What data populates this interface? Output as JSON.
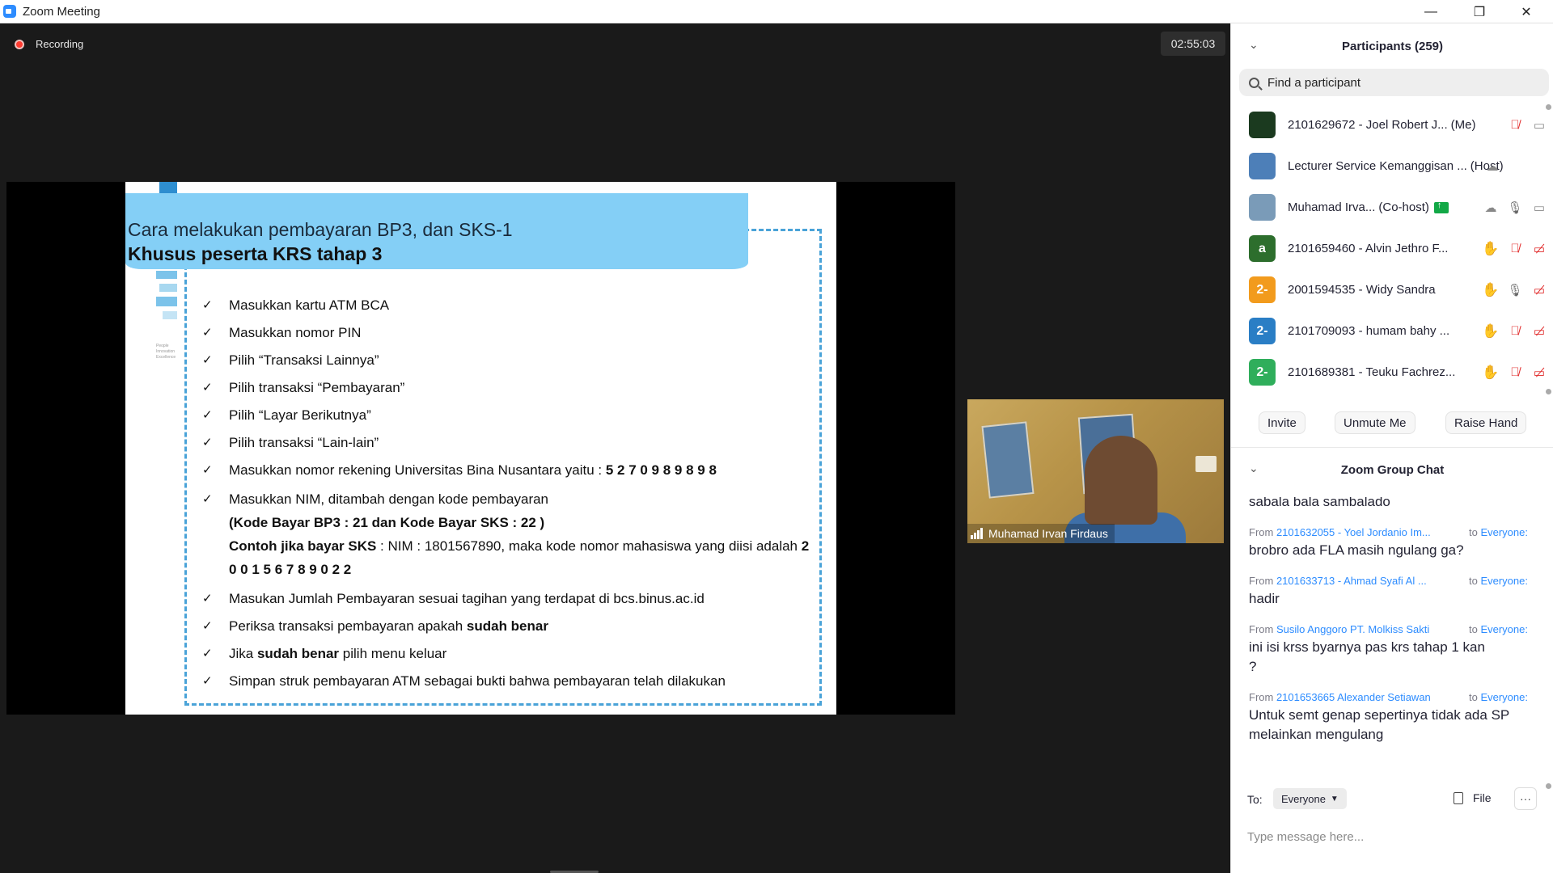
{
  "window": {
    "title": "Zoom Meeting",
    "controls": {
      "minimize": "—",
      "maximize": "❐",
      "close": "✕"
    }
  },
  "meeting": {
    "recording_label": "Recording",
    "elapsed_time": "02:55:03"
  },
  "slide": {
    "title": "Cara melakukan pembayaran BP3, dan SKS-1",
    "subtitle": "Khusus peserta KRS tahap 3",
    "side_text": "People\nInnovation\nExcellence",
    "items": [
      {
        "text": "Masukkan kartu ATM BCA"
      },
      {
        "text": "Masukkan nomor PIN"
      },
      {
        "text": "Pilih “Transaksi Lainnya”"
      },
      {
        "text": "Pilih transaksi “Pembayaran”"
      },
      {
        "text": "Pilih “Layar Berikutnya”"
      },
      {
        "text": "Pilih transaksi “Lain-lain”"
      },
      {
        "text": "Masukkan nomor rekening Universitas Bina Nusantara yaitu : ",
        "bold": "5 2 7 0 9 8 9 8 9 8"
      },
      {
        "text": "Masukkan NIM, ditambah dengan kode pembayaran",
        "line2_bold": "(Kode Bayar BP3 : 21 dan Kode Bayar SKS : 22 )",
        "line3_bold": "Contoh jika bayar SKS",
        "line3_text": " : NIM : 1801567890, maka kode nomor mahasiswa yang diisi adalah ",
        "line3_bold2": "2 0 0 1 5 6 7 8 9 0 2 2"
      },
      {
        "text": "Masukan Jumlah Pembayaran sesuai tagihan yang terdapat di bcs.binus.ac.id"
      },
      {
        "text": "Periksa transaksi pembayaran apakah ",
        "bold": "sudah benar"
      },
      {
        "text": "Jika ",
        "bold": "sudah benar",
        "after": " pilih menu keluar"
      },
      {
        "text": "Simpan struk pembayaran ATM sebagai bukti bahwa pembayaran telah dilakukan"
      }
    ]
  },
  "speaker": {
    "name": "Muhamad Irvan Firdaus"
  },
  "participants_panel": {
    "title": "Participants (259)",
    "search_placeholder": "Find a participant",
    "participants": [
      {
        "name": "2101629672 - Joel Robert J...",
        "tag": "(Me)",
        "avatar_color": "#1b3a1f",
        "avatar_text": "",
        "icons": [
          "mute",
          "video"
        ]
      },
      {
        "name": "Lecturer Service Kemanggisan ...",
        "tag": "(Host)",
        "avatar_color": "#4d7fb8",
        "avatar_text": "",
        "icons": [
          "cloud"
        ]
      },
      {
        "name": "Muhamad Irva...",
        "tag": "(Co-host)",
        "avatar_color": "#7a9bb8",
        "avatar_text": "",
        "icons": [
          "share",
          "cloud",
          "mic",
          "video"
        ]
      },
      {
        "name": "2101659460 - Alvin Jethro F...",
        "tag": "",
        "avatar_color": "#2d6e2d",
        "avatar_text": "a",
        "icons": [
          "hand",
          "mute",
          "videooff"
        ]
      },
      {
        "name": "2001594535 - Widy Sandra",
        "tag": "",
        "avatar_color": "#f29b1d",
        "avatar_text": "2-",
        "icons": [
          "hand",
          "mic",
          "videooff"
        ]
      },
      {
        "name": "2101709093 - humam bahy ...",
        "tag": "",
        "avatar_color": "#2a7ec5",
        "avatar_text": "2-",
        "icons": [
          "hand",
          "mute",
          "videooff"
        ]
      },
      {
        "name": "2101689381 - Teuku Fachrez...",
        "tag": "",
        "avatar_color": "#2fae5b",
        "avatar_text": "2-",
        "icons": [
          "hand",
          "mute",
          "videooff"
        ]
      }
    ],
    "buttons": {
      "invite": "Invite",
      "unmute": "Unmute Me",
      "raise_hand": "Raise Hand"
    }
  },
  "chat_panel": {
    "title": "Zoom Group Chat",
    "messages": [
      {
        "from_prefix": "",
        "from": "",
        "to_prefix": "",
        "to": "",
        "text": "sabala bala sambalado"
      },
      {
        "from_prefix": "From ",
        "from": "2101632055 - Yoel Jordanio Im...",
        "to_prefix": "to ",
        "to": "Everyone:",
        "text": "brobro ada FLA masih ngulang ga?"
      },
      {
        "from_prefix": "From ",
        "from": "2101633713 - Ahmad Syafi Al ...",
        "to_prefix": "to ",
        "to": "Everyone:",
        "text": "hadir"
      },
      {
        "from_prefix": "From ",
        "from": "Susilo Anggoro PT. Molkiss Sakti",
        "to_prefix": "to ",
        "to": "Everyone:",
        "text": "ini isi krss byarnya pas krs tahap 1 kan ?"
      },
      {
        "from_prefix": "From ",
        "from": "2101653665 Alexander Setiawan",
        "to_prefix": "to ",
        "to": "Everyone:",
        "text": "Untuk semt genap sepertinya tidak ada SP melainkan mengulang"
      }
    ],
    "to_label": "To:",
    "to_value": "Everyone",
    "file_label": "File",
    "more_label": "···",
    "input_placeholder": "Type message here..."
  }
}
